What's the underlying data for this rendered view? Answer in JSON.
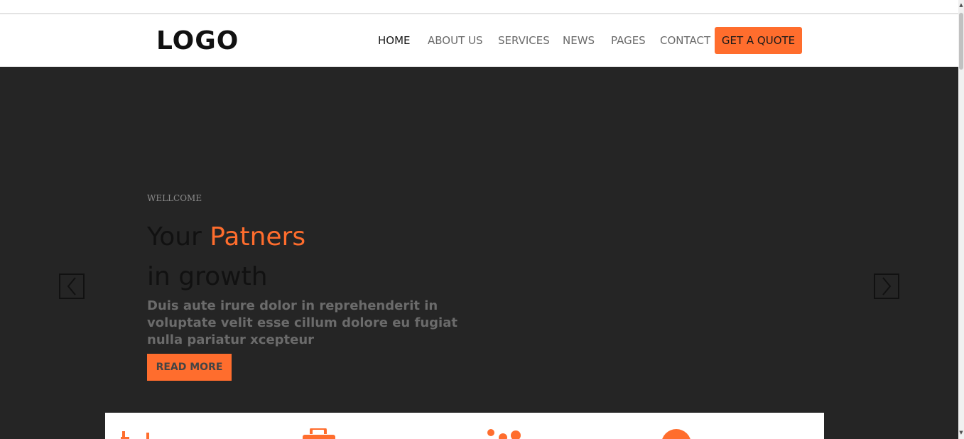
{
  "header": {
    "logo": "LOGO",
    "nav": [
      "HOME",
      "ABOUT US",
      "SERVICES",
      "NEWS",
      "PAGES",
      "CONTACT"
    ],
    "active_nav": "HOME",
    "cta": "GET A QUOTE"
  },
  "hero": {
    "eyebrow": "WELLCOME",
    "headline_pre": "Your ",
    "headline_accent": "Patners",
    "headline_line2": "in growth",
    "lead": "Duis aute irure dolor in reprehenderit in voluptate velit esse cillum dolore eu fugiat nulla pariatur xcepteur",
    "button": "READ MORE",
    "prev_icon": "chevron-left-icon",
    "next_icon": "chevron-right-icon"
  },
  "features": {
    "icons": [
      "chart-icon",
      "briefcase-icon",
      "team-icon",
      "circle-icon"
    ]
  },
  "colors": {
    "accent": "#ff6d2d",
    "hero_bg": "#252525",
    "header_bg": "#ffffff"
  }
}
